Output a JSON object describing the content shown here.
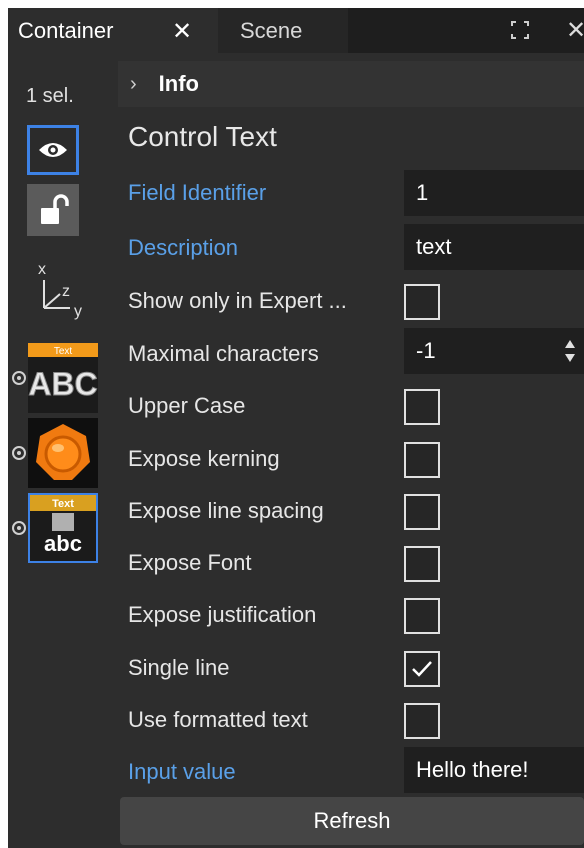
{
  "tabs": [
    {
      "label": "Container",
      "close_glyph": "✕",
      "active": true
    },
    {
      "label": "Scene",
      "active": false
    }
  ],
  "window_controls": {
    "maximize_icon": "expand-icon",
    "close_glyph": "✕"
  },
  "toolbar": {
    "selection_count": "1 sel.",
    "visibility_icon": "eye-icon",
    "lock_icon": "unlock-icon",
    "axis_labels": {
      "x": "x",
      "y": "y",
      "z": "z"
    },
    "plugins": [
      {
        "name": "text-plugin",
        "badge": "Text",
        "glyph": "ABC"
      },
      {
        "name": "geometry-plugin"
      },
      {
        "name": "control-text-plugin",
        "badge": "Text",
        "glyph": "abc",
        "selected": true
      }
    ]
  },
  "panel": {
    "header": "Info",
    "title": "Control Text",
    "fields": {
      "field_identifier": {
        "label": "Field Identifier",
        "value": "1"
      },
      "description": {
        "label": "Description",
        "value": "text"
      },
      "show_expert": {
        "label": "Show only in Expert ...",
        "checked": false
      },
      "max_chars": {
        "label": "Maximal characters",
        "value": "-1"
      },
      "upper_case": {
        "label": "Upper Case",
        "checked": false
      },
      "expose_kerning": {
        "label": "Expose kerning",
        "checked": false
      },
      "expose_line_spacing": {
        "label": "Expose line spacing",
        "checked": false
      },
      "expose_font": {
        "label": "Expose Font",
        "checked": false
      },
      "expose_justification": {
        "label": "Expose justification",
        "checked": false
      },
      "single_line": {
        "label": "Single line",
        "checked": true
      },
      "use_formatted": {
        "label": "Use formatted text",
        "checked": false
      },
      "input_value": {
        "label": "Input value",
        "value": "Hello there!"
      }
    },
    "refresh_label": "Refresh"
  },
  "colors": {
    "accent_blue": "#3d82e6",
    "label_blue": "#5aa0e8",
    "panel_bg": "#2d2d2d",
    "field_bg": "#1f1f1f"
  }
}
